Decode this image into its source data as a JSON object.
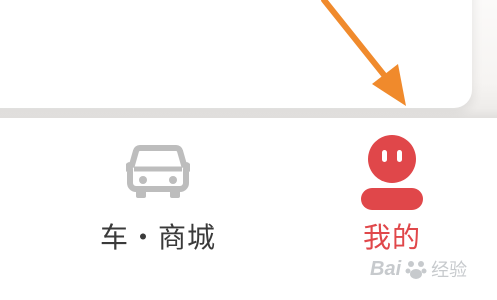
{
  "tabbar": {
    "tabs": [
      {
        "label": "车・商城",
        "icon": "car-icon",
        "active": false
      },
      {
        "label": "我的",
        "icon": "profile-icon",
        "active": true
      }
    ]
  },
  "annotation": {
    "icon": "orange-arrow-icon",
    "color": "#f08a2c"
  },
  "watermark": {
    "brand": "Bai",
    "suffix": "经验"
  },
  "colors": {
    "active": "#e0474a",
    "inactive_icon": "#bdbdbd",
    "inactive_text": "#3a3a3a"
  }
}
